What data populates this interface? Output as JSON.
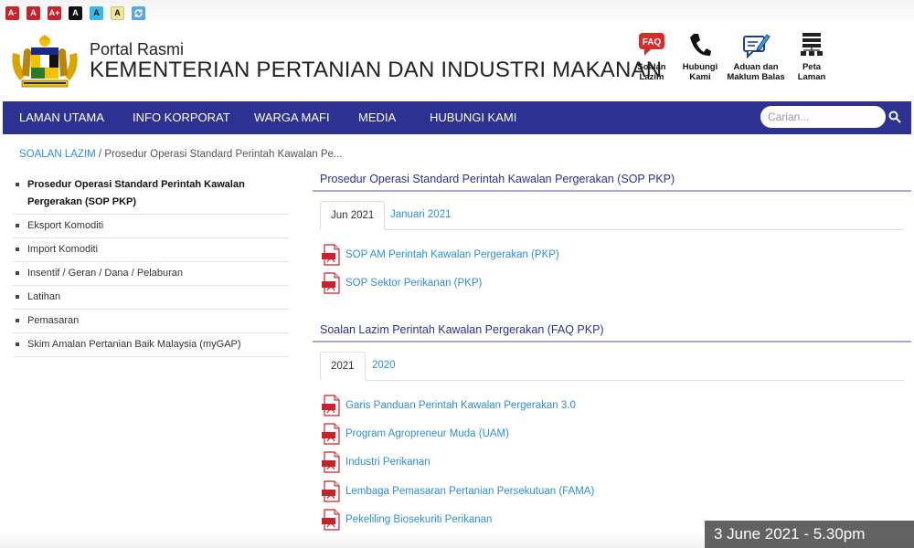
{
  "accessibility": {
    "buttons": [
      {
        "label": "A-",
        "style": "red"
      },
      {
        "label": "A",
        "style": "red"
      },
      {
        "label": "A+",
        "style": "red"
      },
      {
        "label": "A",
        "style": "black"
      },
      {
        "label": "A",
        "style": "blue"
      },
      {
        "label": "A",
        "style": "yellow"
      }
    ]
  },
  "header": {
    "portal_label": "Portal Rasmi",
    "ministry_name": "KEMENTERIAN PERTANIAN DAN INDUSTRI MAKANAN",
    "quick_links": [
      {
        "label_line1": "Soalan",
        "label_line2": "Lazim",
        "icon": "faq-icon",
        "icon_text": "FAQ"
      },
      {
        "label_line1": "Hubungi",
        "label_line2": "Kami",
        "icon": "phone-icon"
      },
      {
        "label_line1": "Aduan dan",
        "label_line2": "Maklum Balas",
        "icon": "feedback-icon"
      },
      {
        "label_line1": "Peta",
        "label_line2": "Laman",
        "icon": "sitemap-icon"
      }
    ]
  },
  "nav": {
    "items": [
      "LAMAN UTAMA",
      "INFO KORPORAT",
      "WARGA MAFI",
      "MEDIA",
      "HUBUNGI KAMI"
    ],
    "search_placeholder": "Carian..."
  },
  "breadcrumb": {
    "parent": "SOALAN LAZIM",
    "separator": "/",
    "current": "Prosedur Operasi Standard Perintah Kawalan Pe..."
  },
  "sidebar": {
    "items": [
      {
        "label": "Prosedur Operasi Standard Perintah Kawalan Pergerakan (SOP PKP)",
        "active": true
      },
      {
        "label": "Eksport Komoditi"
      },
      {
        "label": "Import Komoditi"
      },
      {
        "label": "Insentif / Geran / Dana / Pelaburan"
      },
      {
        "label": "Latihan"
      },
      {
        "label": "Pemasaran"
      },
      {
        "label": "Skim Amalan Pertanian Baik Malaysia (myGAP)"
      }
    ]
  },
  "sections": [
    {
      "title": "Prosedur Operasi Standard Perintah Kawalan Pergerakan (SOP PKP)",
      "tabs": [
        {
          "label": "Jun 2021",
          "active": true
        },
        {
          "label": "Januari 2021"
        }
      ],
      "documents": [
        "SOP AM Perintah Kawalan Pergerakan (PKP)",
        "SOP Sektor Perikanan (PKP)"
      ]
    },
    {
      "title": "Soalan Lazim Perintah Kawalan Pergerakan (FAQ PKP)",
      "tabs": [
        {
          "label": "2021",
          "active": true
        },
        {
          "label": "2020"
        }
      ],
      "documents": [
        "Garis Panduan Perintah Kawalan Pergerakan 3.0",
        "Program Agropreneur Muda (UAM)",
        "Industri Perikanan",
        "Lembaga Pemasaran Pertanian Persekutuan (FAMA)",
        "Pekeliling Biosekuriti Perikanan"
      ]
    }
  ],
  "overlay": {
    "timestamp": "3 June 2021 - 5.30pm"
  },
  "colors": {
    "nav_background": "#2d3192",
    "link": "#2f8fd6",
    "pdf_red": "#c8232c"
  }
}
